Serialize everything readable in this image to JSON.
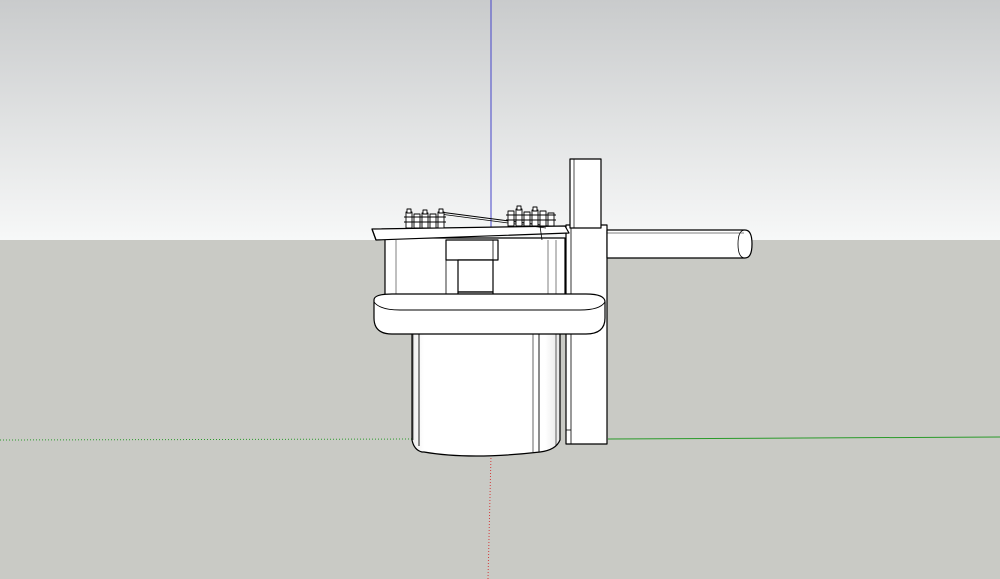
{
  "viewport": {
    "projection": "perspective",
    "style": "hidden-line / monochrome",
    "sky_colors": [
      "#c9cbcc",
      "#f7f8f8"
    ],
    "ground_color": "#c9cac5",
    "axis_colors": {
      "red": "#d23c3c",
      "green": "#2a9a2a",
      "blue": "#4545c9"
    },
    "model": {
      "fill": "#ffffff",
      "edge": "#000000"
    }
  }
}
